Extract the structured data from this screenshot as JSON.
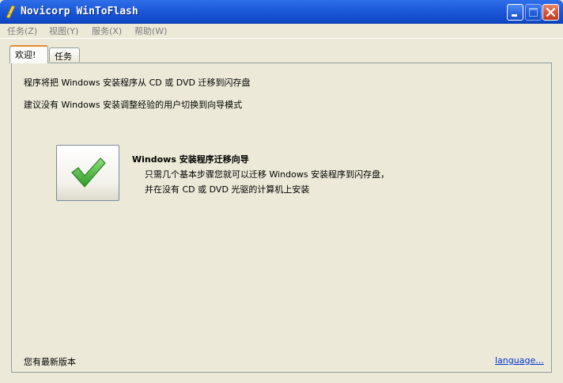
{
  "window": {
    "title": "Novicorp WinToFlash"
  },
  "menu": {
    "items": [
      "任务(Z)",
      "视图(Y)",
      "服务(X)",
      "帮助(W)"
    ]
  },
  "tabs": {
    "welcome": "欢迎!",
    "tasks": "任务"
  },
  "intro": {
    "line1": "程序将把 Windows 安装程序从 CD 或 DVD 迁移到闪存盘",
    "line2": "建议没有 Windows 安装调整经验的用户切换到向导模式"
  },
  "wizard": {
    "title": "Windows 安装程序迁移向导",
    "desc1": "只需几个基本步骤您就可以迁移 Windows 安装程序到闪存盘，",
    "desc2": "并在没有 CD 或 DVD 光驱的计算机上安装"
  },
  "footer": {
    "status": "您有最新版本",
    "language_link": "language..."
  },
  "colors": {
    "titlebar": "#0f49c7",
    "close": "#d4512f",
    "check": "#3aa63a",
    "link": "#0033cc"
  }
}
